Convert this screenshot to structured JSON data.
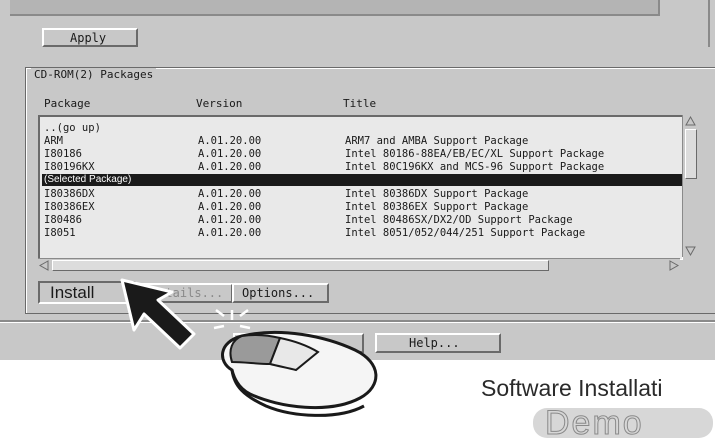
{
  "toolbar": {
    "apply_label": "Apply"
  },
  "packages_group": {
    "label": "CD-ROM(2) Packages",
    "columns": {
      "package": "Package",
      "version": "Version",
      "title": "Title"
    },
    "rows": [
      {
        "package": "..(go up)",
        "version": "",
        "title": ""
      },
      {
        "package": "ARM",
        "version": "A.01.20.00",
        "title": "ARM7 and AMBA Support Package"
      },
      {
        "package": "I80186",
        "version": "A.01.20.00",
        "title": "Intel 80186-88EA/EB/EC/XL Support Package"
      },
      {
        "package": "I80196KX",
        "version": "A.01.20.00",
        "title": "Intel 80C196KX and MCS-96 Support Package"
      },
      {
        "package": "I80386DX",
        "version": "A.01.20.00",
        "title": "Intel 80386DX Support Package"
      },
      {
        "package": "I80386EX",
        "version": "A.01.20.00",
        "title": "Intel 80386EX Support Package"
      },
      {
        "package": "I80486",
        "version": "A.01.20.00",
        "title": "Intel 80486SX/DX2/OD Support Package"
      },
      {
        "package": "I8051",
        "version": "A.01.20.00",
        "title": "Intel 8051/052/044/251 Support Package"
      }
    ],
    "selected_label": "(Selected Package)"
  },
  "actions": {
    "install_label": "Install",
    "details_label": "Details...",
    "options_label": "Options..."
  },
  "bottom": {
    "help_label": "Help..."
  },
  "caption": {
    "title": "Software Installati",
    "demo": "Demo"
  },
  "colors": {
    "window_bg": "#c8c8c8",
    "list_bg": "#e9e9e9",
    "selection_bg": "#1a1a1a"
  }
}
